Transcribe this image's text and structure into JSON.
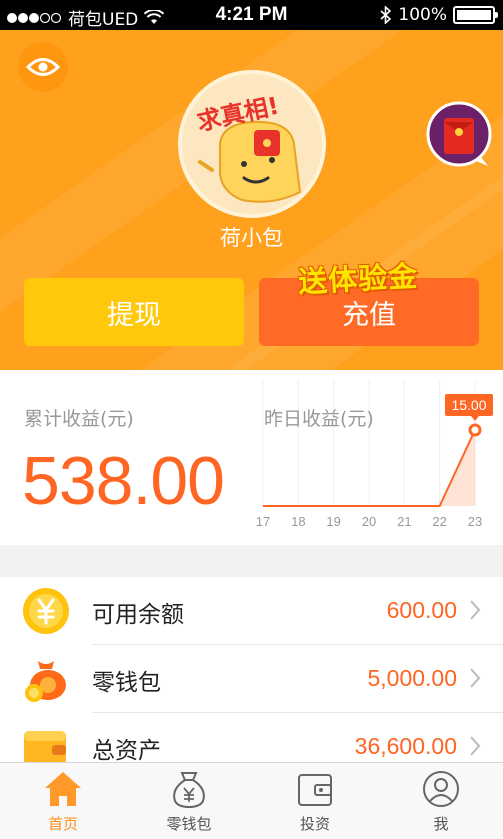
{
  "status_bar": {
    "carrier": "荷包UED",
    "time": "4:21 PM",
    "battery": "100%"
  },
  "hero": {
    "avatar_sticker": "求真相!",
    "username": "荷小包",
    "withdraw_label": "提现",
    "recharge_label": "充值",
    "promo_label": "送体验金"
  },
  "earnings": {
    "cumulative_label": "累计收益(元)",
    "cumulative_value": "538.00",
    "yesterday_label": "昨日收益(元)"
  },
  "chart_data": {
    "type": "area",
    "x": [
      "17",
      "18",
      "19",
      "20",
      "21",
      "22",
      "23"
    ],
    "values": [
      0,
      0,
      0,
      0,
      0,
      0,
      15.0
    ],
    "highlight_label": "15.00",
    "color": "#ff6523"
  },
  "accounts": [
    {
      "label": "可用余额",
      "value": "600.00",
      "icon": "yen-coin-icon"
    },
    {
      "label": "零钱包",
      "value": "5,000.00",
      "icon": "money-bag-icon"
    },
    {
      "label": "总资产",
      "value": "36,600.00",
      "icon": "wallet-icon"
    }
  ],
  "tabs": [
    {
      "label": "首页",
      "icon": "home-icon",
      "active": true
    },
    {
      "label": "零钱包",
      "icon": "yen-bag-icon",
      "active": false
    },
    {
      "label": "投资",
      "icon": "invest-wallet-icon",
      "active": false
    },
    {
      "label": "我",
      "icon": "user-icon",
      "active": false
    }
  ],
  "colors": {
    "brand_orange": "#ffa11d",
    "accent_red_orange": "#ff6523",
    "withdraw_yellow": "#ffc80a",
    "recharge_orange": "#ff6a26"
  }
}
